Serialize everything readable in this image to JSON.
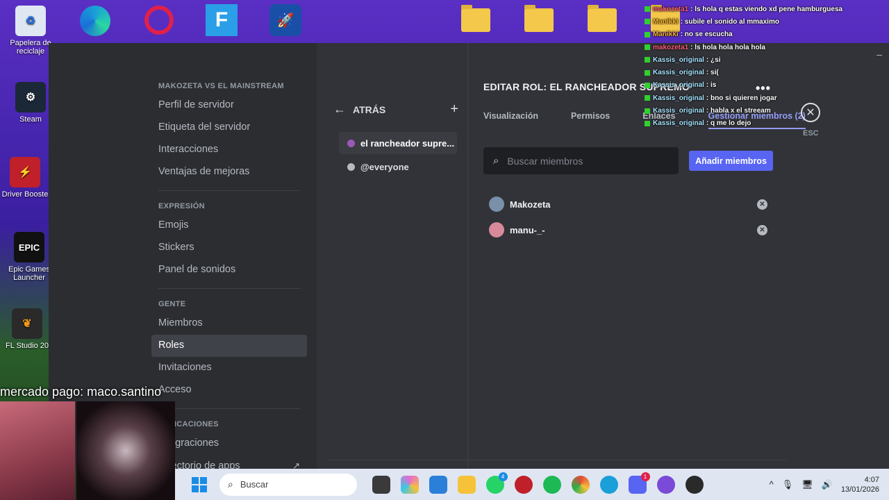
{
  "desktop": {
    "icons": [
      {
        "label": "Papelera de reciclaje",
        "icon": "recycle-bin-icon"
      },
      {
        "label": "Steam",
        "icon": "steam-icon"
      },
      {
        "label": "Driver Booste",
        "icon": "driver-booster-icon",
        "badge": "9+"
      },
      {
        "label": "Epic Games Launcher",
        "icon": "epic-games-icon"
      },
      {
        "label": "FL Studio 20",
        "icon": "fl-studio-icon"
      }
    ]
  },
  "settings": {
    "sections": [
      {
        "header": "MAKOZETA VS EL MAINSTREAM",
        "items": [
          "Perfil de servidor",
          "Etiqueta del servidor",
          "Interacciones",
          "Ventajas de mejoras"
        ]
      },
      {
        "header": "EXPRESIÓN",
        "items": [
          "Emojis",
          "Stickers",
          "Panel de sonidos"
        ]
      },
      {
        "header": "GENTE",
        "items": [
          "Miembros",
          "Roles",
          "Invitaciones",
          "Acceso"
        ]
      },
      {
        "header": "APLICACIONES",
        "items": [
          "Integraciones",
          "Directorio de apps"
        ]
      }
    ],
    "active_item": "Roles"
  },
  "roles_panel": {
    "back_label": "ATRÁS",
    "roles": [
      {
        "name": "el rancheador supre...",
        "color": "#9b59b6",
        "active": true
      },
      {
        "name": "@everyone",
        "color": "#b5bac1",
        "active": false
      }
    ]
  },
  "edit_role": {
    "title": "EDITAR ROL: EL RANCHEADOR SUPREMO",
    "tabs": [
      "Visualización",
      "Permisos",
      "Enlaces",
      "Gestionar miembros (2)"
    ],
    "active_tab": "Gestionar miembros (2)",
    "search_placeholder": "Buscar miembros",
    "add_members_label": "Añadir miembros",
    "members": [
      {
        "name": "Makozeta",
        "avatar_color": "#7a8fa8"
      },
      {
        "name": "manu-_-",
        "avatar_color": "#d88a9a"
      }
    ],
    "esc_label": "ESC"
  },
  "chat": [
    {
      "user": "makozeta1",
      "msg": ": ls hola q estas viendo xd pene hamburguesa"
    },
    {
      "user": "Manikki",
      "msg": ": subile el sonido al mmaximo"
    },
    {
      "user": "Manikki",
      "msg": ": no se escucha"
    },
    {
      "user": "makozeta1",
      "msg": ": ls hola hola hola hola"
    },
    {
      "user": "Kassis_original",
      "msg": ": ¿si"
    },
    {
      "user": "Kassis_original",
      "msg": ": si("
    },
    {
      "user": "Kassis_original",
      "msg": ": is"
    },
    {
      "user": "Kassis_original",
      "msg": ": bno si quieren jogar"
    },
    {
      "user": "Kassis_original",
      "msg": ": habla x el streeam"
    },
    {
      "user": "Kassis_original",
      "msg": ": q me lo dejo"
    }
  ],
  "donation_text": "mercado pago: maco.santino",
  "taskbar": {
    "search_label": "Buscar",
    "apps": [
      {
        "name": "file-explorer-icon",
        "color": "#f5c23a"
      },
      {
        "name": "copilot-icon",
        "color": "#e86ad0"
      },
      {
        "name": "store-icon",
        "color": "#2a7fd8"
      },
      {
        "name": "folder-icon",
        "color": "#f5c23a"
      },
      {
        "name": "whatsapp-icon",
        "color": "#25d366",
        "badge": "4"
      },
      {
        "name": "app-red-icon",
        "color": "#c0202a"
      },
      {
        "name": "spotify-icon",
        "color": "#1db954"
      },
      {
        "name": "chrome-icon",
        "color": "#e04a3a"
      },
      {
        "name": "edge-icon",
        "color": "#1a9fd8"
      },
      {
        "name": "discord-icon",
        "color": "#5865f2",
        "badge": "1"
      },
      {
        "name": "app-purple-icon",
        "color": "#7a4ad8"
      },
      {
        "name": "obs-icon",
        "color": "#2a2a2a"
      }
    ],
    "time": "4:07",
    "date": "13/01/2026"
  }
}
